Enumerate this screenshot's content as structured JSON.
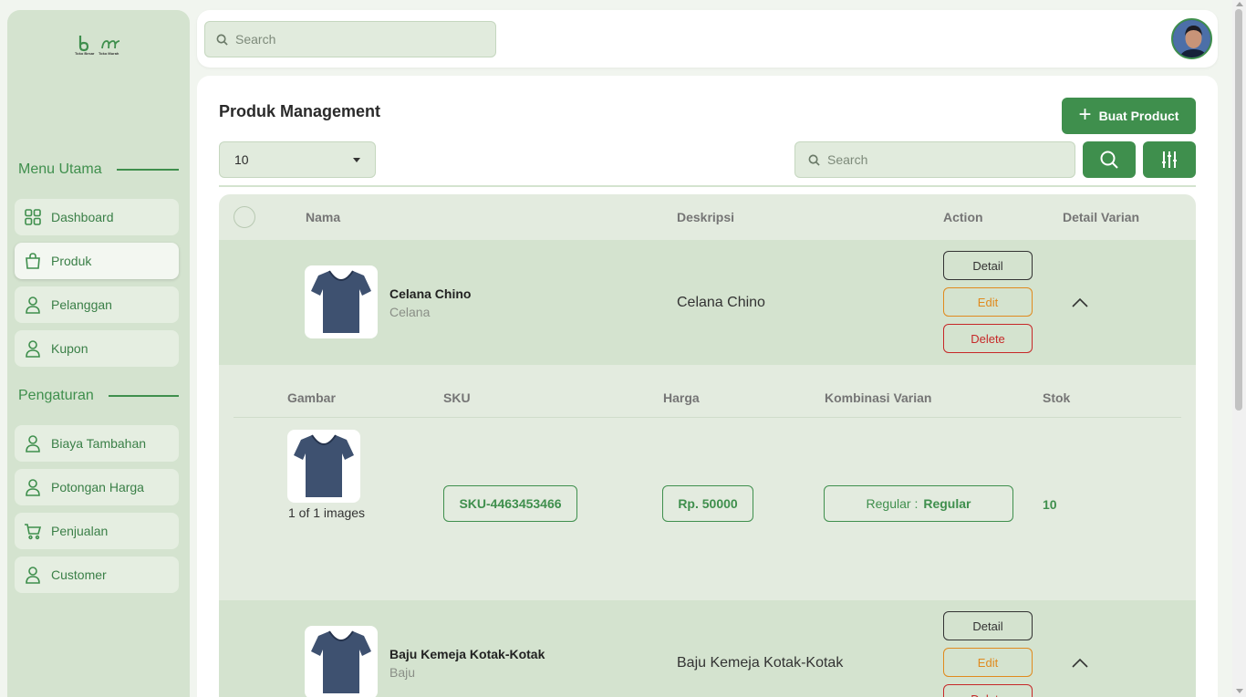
{
  "brand": {
    "logo_text_left": "Toko Besar",
    "logo_text_right": "Toko Murah",
    "accent": "#3f8f4d"
  },
  "sidebar": {
    "section_main": "Menu Utama",
    "main_items": [
      {
        "label": "Dashboard",
        "icon": "grid-icon"
      },
      {
        "label": "Produk",
        "icon": "shopping-bag-icon",
        "active": true
      },
      {
        "label": "Pelanggan",
        "icon": "user-icon"
      },
      {
        "label": "Kupon",
        "icon": "user-icon"
      }
    ],
    "section_settings": "Pengaturan",
    "settings_items": [
      {
        "label": "Biaya Tambahan",
        "icon": "user-icon"
      },
      {
        "label": "Potongan Harga",
        "icon": "user-icon"
      },
      {
        "label": "Penjualan",
        "icon": "cart-icon"
      },
      {
        "label": "Customer",
        "icon": "user-icon"
      }
    ]
  },
  "topbar": {
    "search_placeholder": "Search"
  },
  "main": {
    "title": "Produk Management",
    "create_button": "Buat Product",
    "per_page": "10",
    "search_placeholder": "Search"
  },
  "table": {
    "headers": {
      "nama": "Nama",
      "deskripsi": "Deskripsi",
      "action": "Action",
      "detail_varian": "Detail Varian"
    },
    "actions": {
      "detail": "Detail",
      "edit": "Edit",
      "delete": "Delete"
    },
    "rows": [
      {
        "name": "Celana Chino",
        "category": "Celana",
        "description": "Celana Chino"
      },
      {
        "name": "Baju Kemeja Kotak-Kotak",
        "category": "Baju",
        "description": "Baju Kemeja Kotak-Kotak"
      }
    ]
  },
  "variant": {
    "headers": {
      "gambar": "Gambar",
      "sku": "SKU",
      "harga": "Harga",
      "kombinasi": "Kombinasi Varian",
      "stok": "Stok"
    },
    "image_count": "1 of 1 images",
    "sku": "SKU-4463453466",
    "price": "Rp. 50000",
    "combo_label": "Regular :",
    "combo_value": "Regular",
    "stock": "10"
  }
}
